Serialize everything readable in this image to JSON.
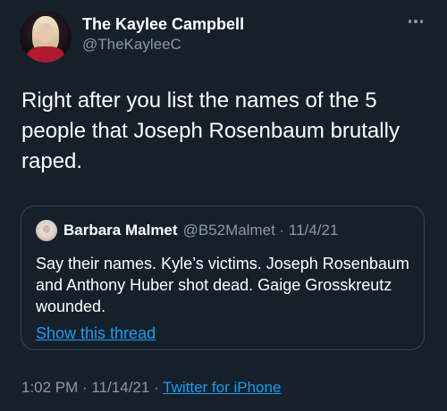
{
  "author": {
    "display_name": "The Kaylee Campbell",
    "handle": "@TheKayleeC"
  },
  "tweet": {
    "text": "Right after you list the names of the 5 people that Joseph Rosenbaum brutally raped."
  },
  "quoted_tweet": {
    "display_name": "Barbara Malmet",
    "meta": "@B52Malmet · 11/4/21",
    "text": "Say their names. Kyle’s victims. Joseph Rosenbaum and Anthony Huber shot dead. Gaige Grosskreutz wounded.",
    "show_thread_label": "Show this thread"
  },
  "footer": {
    "time_date": "1:02 PM · 11/14/21 · ",
    "source": "Twitter for iPhone"
  },
  "colors": {
    "background": "#15202b",
    "text_primary": "#ffffff",
    "text_secondary": "#8899a6",
    "link": "#1d9bf0",
    "border": "#38444d"
  },
  "icons": {
    "more": "more-horizontal-icon"
  }
}
